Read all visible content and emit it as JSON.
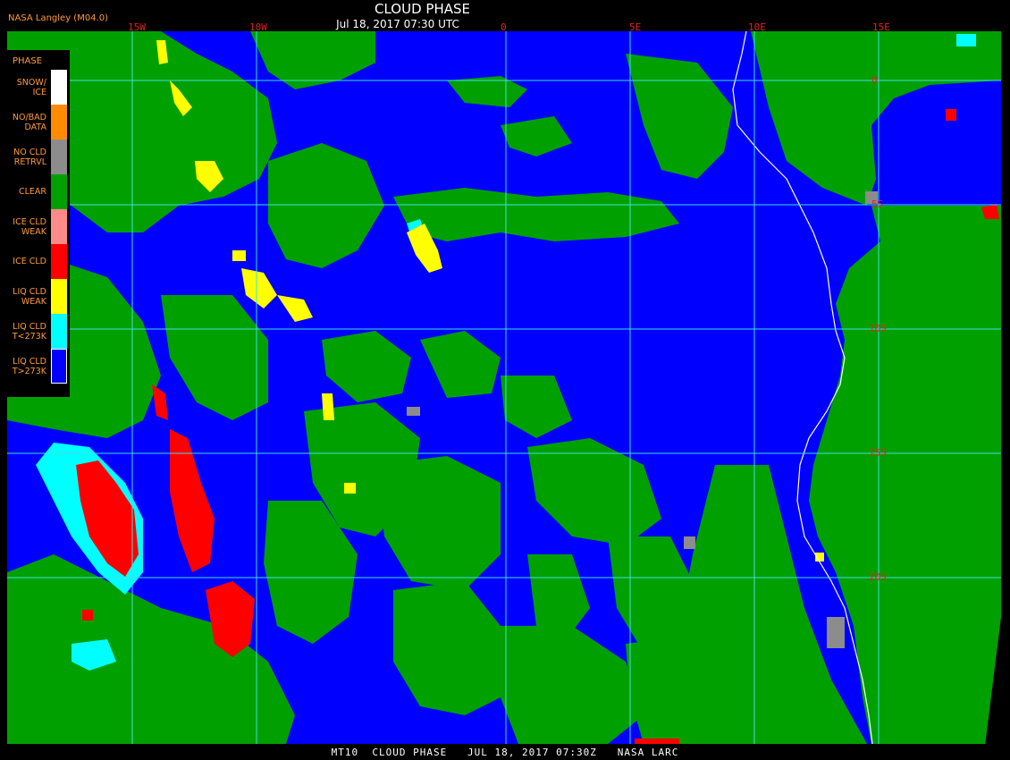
{
  "header": {
    "title": "CLOUD PHASE",
    "datetime": "Jul 18, 2017 07:30 UTC",
    "credit": "NASA Langley (M04.0)"
  },
  "footer": {
    "text": "MT10  CLOUD PHASE   JUL 18, 2017 07:30Z   NASA LARC"
  },
  "legend": {
    "title": "PHASE",
    "items": [
      {
        "label": "SNOW/\nICE",
        "color": "#ffffff"
      },
      {
        "label": "NO/BAD\nDATA",
        "color": "#ff8c00"
      },
      {
        "label": "NO CLD\nRETRVL",
        "color": "#8c8c8c"
      },
      {
        "label": "CLEAR",
        "color": "#00a000"
      },
      {
        "label": "ICE CLD\nWEAK",
        "color": "#ff8a8a"
      },
      {
        "label": "ICE CLD",
        "color": "#ff0000"
      },
      {
        "label": "LIQ CLD\nWEAK",
        "color": "#ffff00"
      },
      {
        "label": "LIQ CLD\nT<273K",
        "color": "#00ffff"
      },
      {
        "label": "LIQ CLD\nT>273K",
        "color": "#0000ff"
      }
    ]
  },
  "grid": {
    "longitudes": [
      "15W",
      "10W",
      "0",
      "5E",
      "10E",
      "15E"
    ],
    "latitudes": [
      "0",
      "5S",
      "10S",
      "15S",
      "20S"
    ],
    "color": "#40e0e0"
  },
  "colors": {
    "ocean": "#0000ff",
    "clear": "#00a000",
    "coastline": "#ffffff"
  }
}
